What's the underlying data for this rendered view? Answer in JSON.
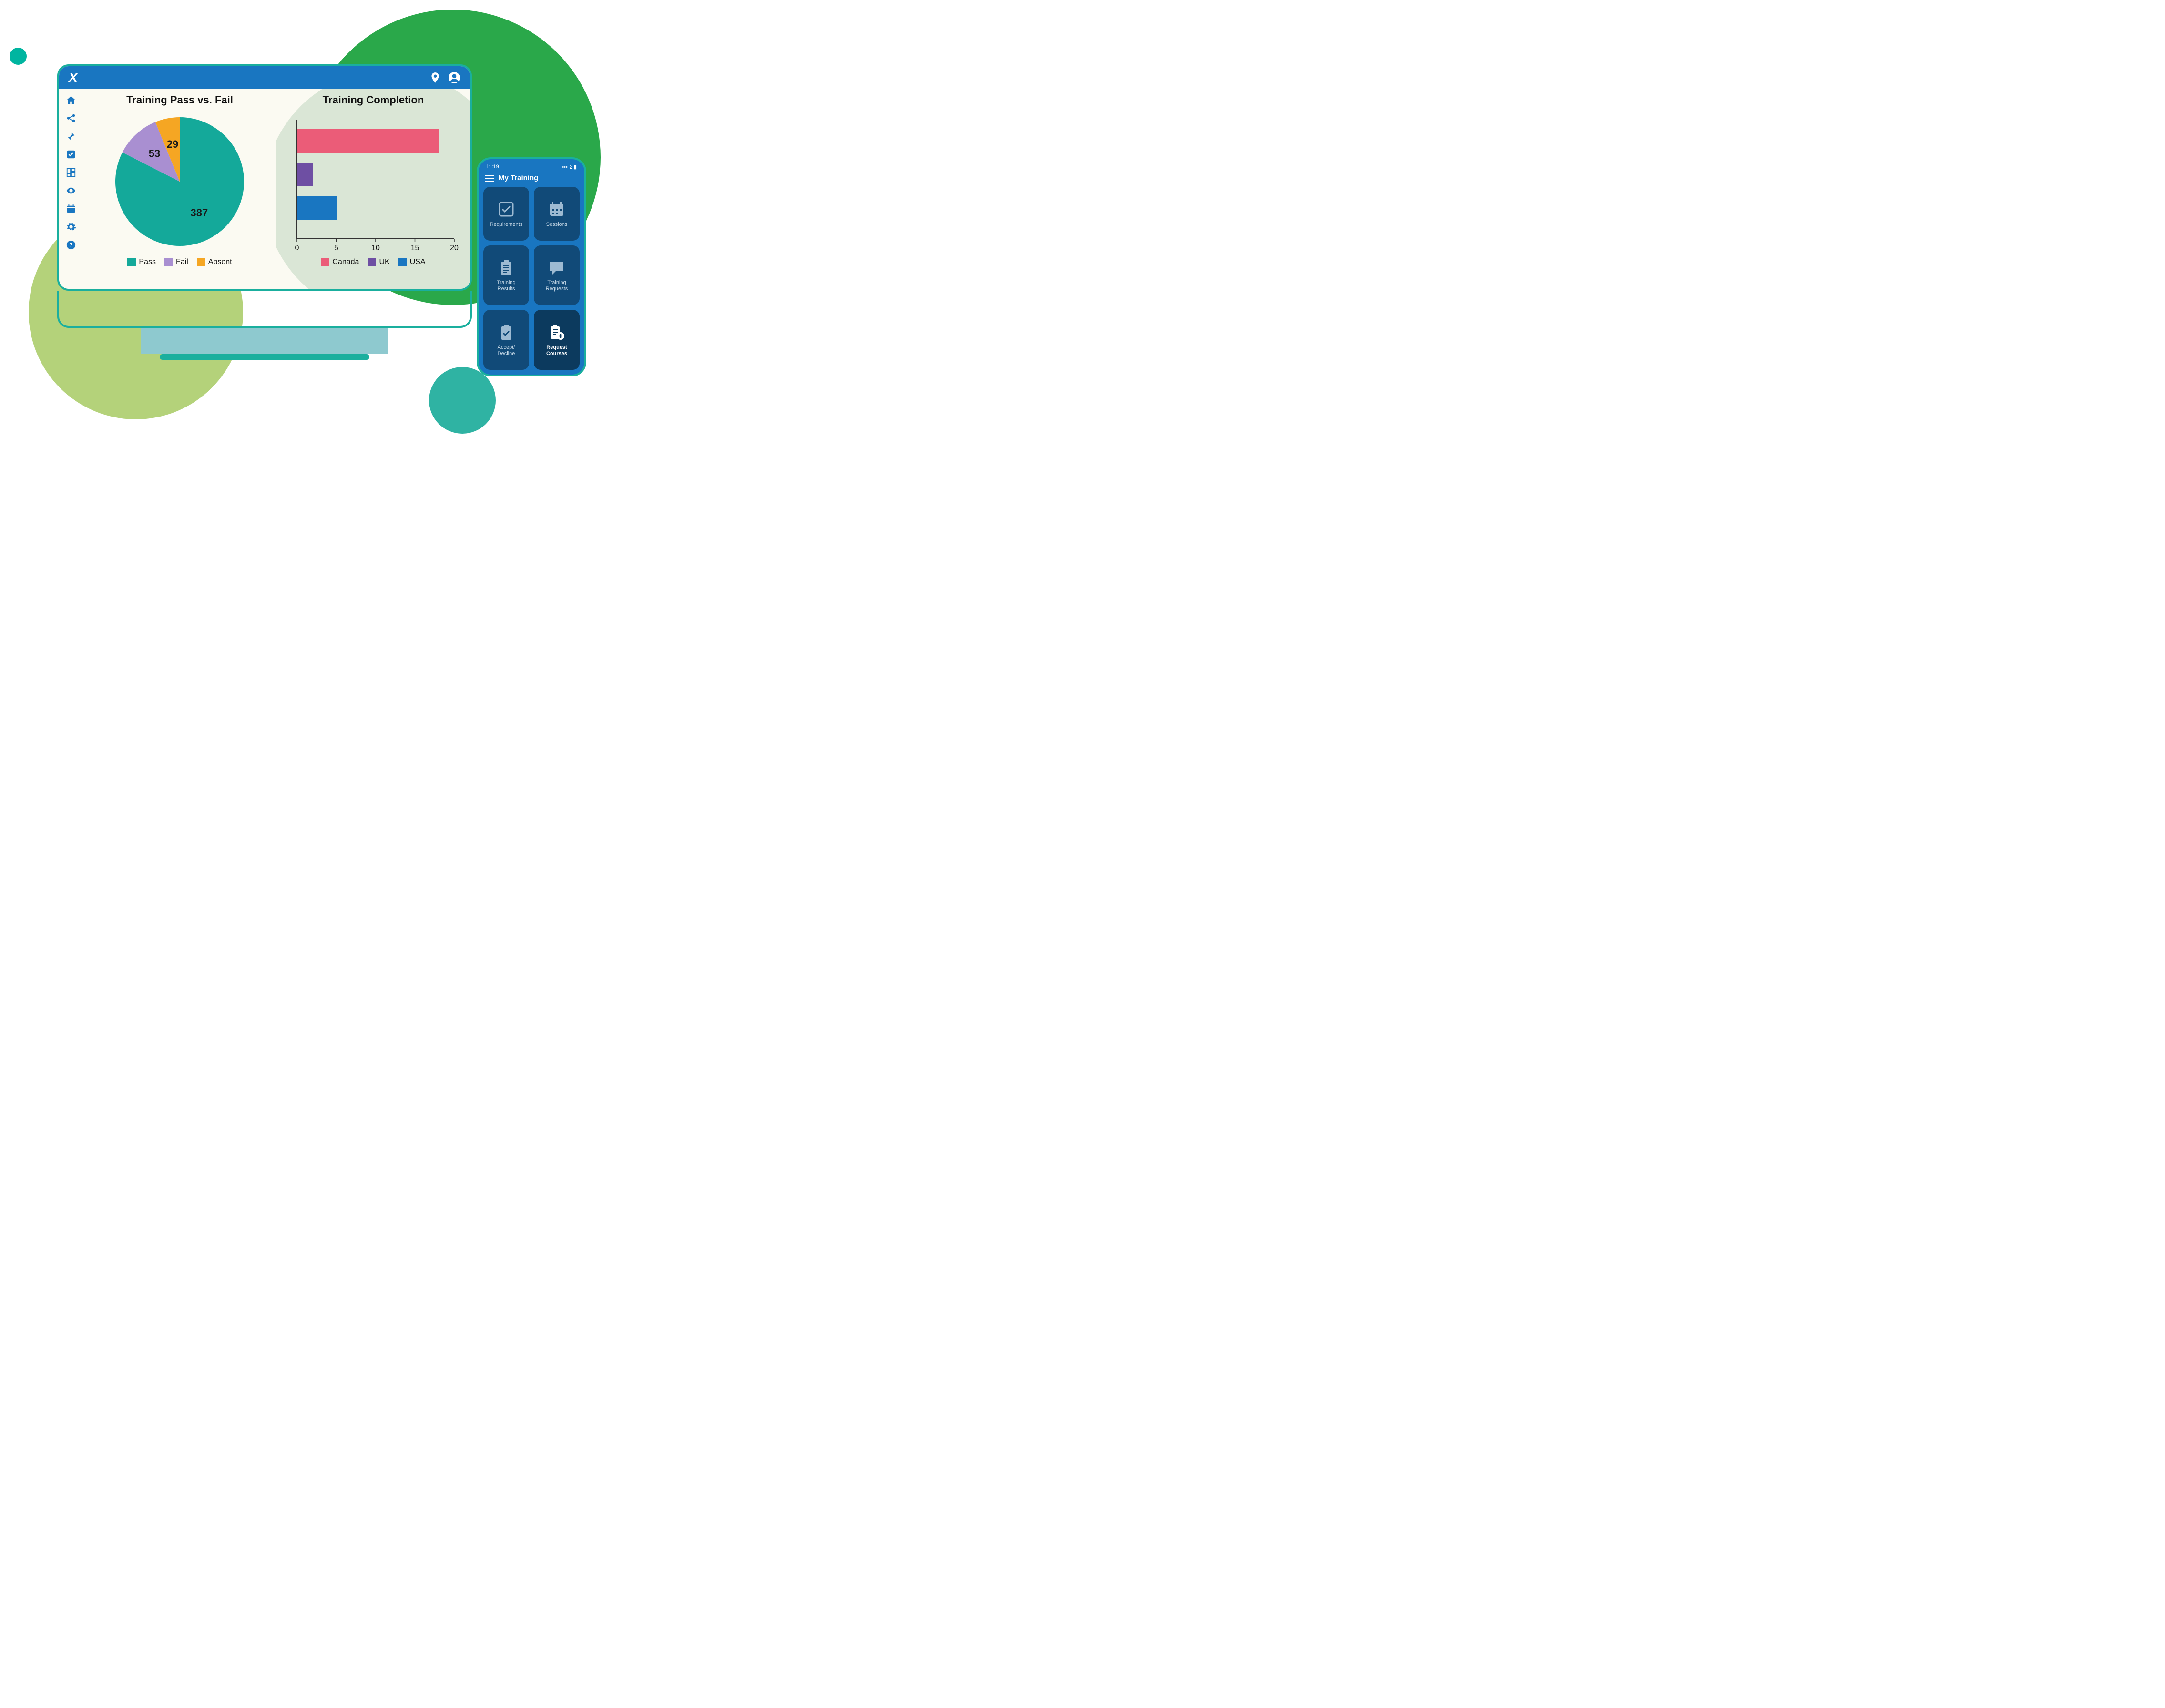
{
  "colors": {
    "teal": "#14a99a",
    "purple": "#a98fd1",
    "orange": "#f5a623",
    "pink": "#eb5c78",
    "blue": "#1976c1"
  },
  "desktop": {
    "pie": {
      "title": "Training Pass vs. Fail",
      "legend": [
        {
          "label": "Pass",
          "color": "#14a99a"
        },
        {
          "label": "Fail",
          "color": "#a98fd1"
        },
        {
          "label": "Absent",
          "color": "#f5a623"
        }
      ]
    },
    "bar": {
      "title": "Training Completion",
      "legend": [
        {
          "label": "Canada",
          "color": "#eb5c78"
        },
        {
          "label": "UK",
          "color": "#6e4fa3"
        },
        {
          "label": "USA",
          "color": "#1976c1"
        }
      ]
    }
  },
  "chart_data": [
    {
      "type": "pie",
      "title": "Training Pass vs. Fail",
      "series": [
        {
          "name": "Pass",
          "value": 387,
          "color": "#14a99a"
        },
        {
          "name": "Fail",
          "value": 53,
          "color": "#a98fd1"
        },
        {
          "name": "Absent",
          "value": 29,
          "color": "#f5a623"
        }
      ]
    },
    {
      "type": "bar",
      "orientation": "horizontal",
      "title": "Training Completion",
      "xlabel": "",
      "ylabel": "",
      "xlim": [
        0,
        20
      ],
      "xticks": [
        0,
        5,
        10,
        15,
        20
      ],
      "series": [
        {
          "name": "Canada",
          "value": 18,
          "color": "#eb5c78"
        },
        {
          "name": "UK",
          "value": 2,
          "color": "#6e4fa3"
        },
        {
          "name": "USA",
          "value": 5,
          "color": "#1976c1"
        }
      ]
    }
  ],
  "phone": {
    "status_time": "11:19",
    "title": "My Training",
    "tiles": [
      {
        "label": "Requirements",
        "icon": "check-square"
      },
      {
        "label": "Sessions",
        "icon": "calendar"
      },
      {
        "label": "Training Results",
        "icon": "clipboard-lines"
      },
      {
        "label": "Training Requests",
        "icon": "speech"
      },
      {
        "label": "Accept/ Decline",
        "icon": "clipboard-check"
      },
      {
        "label": "Request Courses",
        "icon": "clipboard-plus",
        "active": true
      }
    ]
  }
}
